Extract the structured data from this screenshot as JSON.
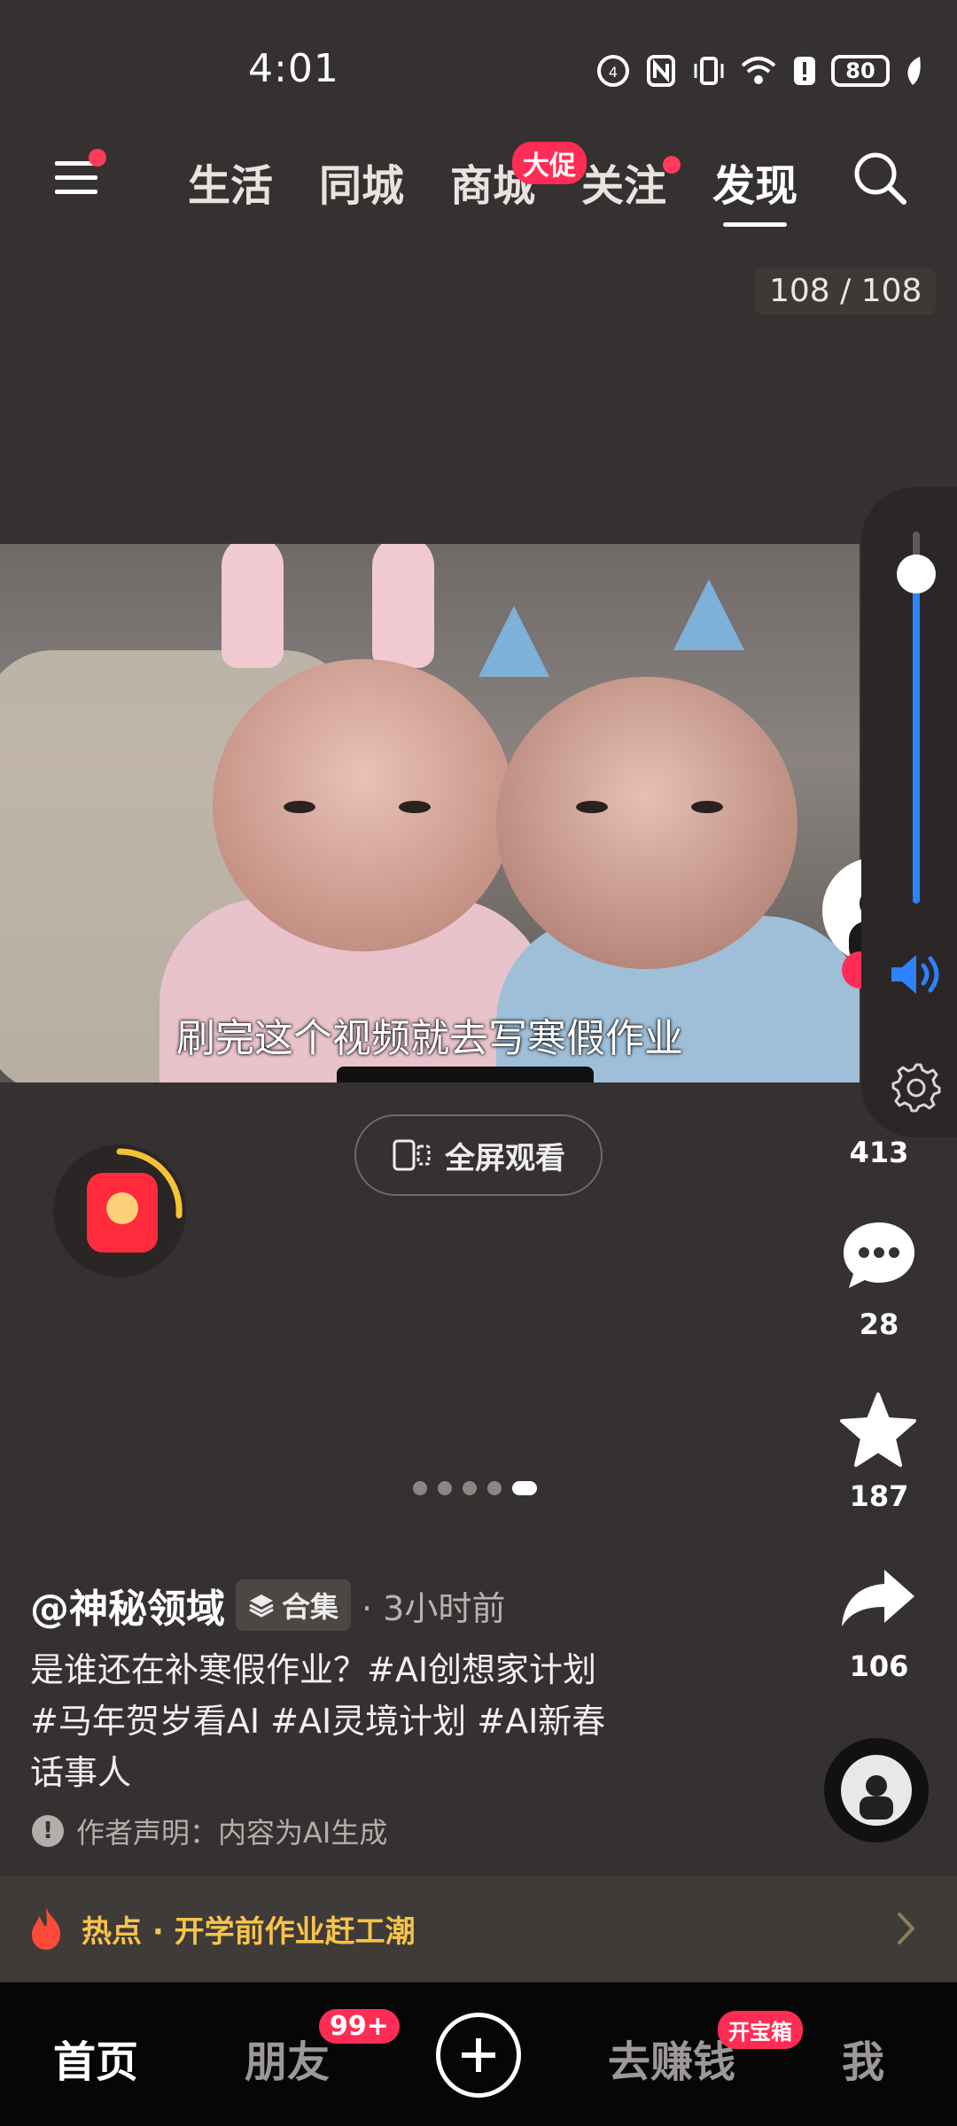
{
  "status_bar": {
    "time": "4:01",
    "battery": "80"
  },
  "top_nav": {
    "tabs": [
      {
        "label": "生活"
      },
      {
        "label": "同城"
      },
      {
        "label": "商城"
      },
      {
        "label": "关注"
      },
      {
        "label": "发现"
      }
    ],
    "mall_badge": "大促",
    "active_tab": "发现"
  },
  "page_counter": "108 / 108",
  "video": {
    "subtitle": "刷完这个视频就去写寒假作业"
  },
  "fullscreen_label": "全屏观看",
  "volume": {
    "level": 0.88
  },
  "actions": {
    "likes": "413",
    "comments": "28",
    "favorites": "187",
    "shares": "106"
  },
  "carousel": {
    "count": 5,
    "active_index": 4
  },
  "post": {
    "author": "@神秘领域",
    "collection_label": "合集",
    "time_ago": "· 3小时前",
    "description": "是谁还在补寒假作业？#AI创想家计划 #马年贺岁看AI #AI灵境计划 #AI新春话事人",
    "disclaimer": "作者声明：内容为AI生成"
  },
  "hot_topic": {
    "text": "热点 · 开学前作业赶工潮"
  },
  "bottom_nav": {
    "home": "首页",
    "friends": "朋友",
    "friends_badge": "99+",
    "earn": "去赚钱",
    "earn_badge": "开宝箱",
    "me": "我"
  },
  "colors": {
    "accent": "#ff2d55",
    "volume_blue": "#2d82ff",
    "hot_yellow": "#f7c34a",
    "background": "#353130"
  }
}
